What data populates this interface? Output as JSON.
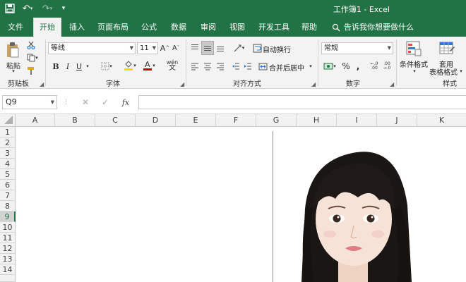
{
  "titlebar": {
    "title": "工作簿1 - Excel"
  },
  "tabs": [
    "文件",
    "开始",
    "插入",
    "页面布局",
    "公式",
    "数据",
    "审阅",
    "视图",
    "开发工具",
    "帮助"
  ],
  "active_tab": "开始",
  "tellme": "告诉我你想要做什么",
  "clipboard": {
    "paste": "粘贴",
    "group": "剪贴板"
  },
  "font": {
    "name": "等线",
    "size": "11",
    "bold": "B",
    "italic": "I",
    "underline": "U",
    "group": "字体",
    "phonetic": "wén"
  },
  "alignment": {
    "wrap": "自动换行",
    "merge": "合并后居中",
    "group": "对齐方式"
  },
  "number": {
    "format": "常规",
    "percent": "%",
    "comma": ",",
    "inc_dec": "←.0 .00",
    "dec_dec": ".00 →.0",
    "group": "数字"
  },
  "styles": {
    "conditional": "条件格式",
    "table_line1": "套用",
    "table_line2": "表格格式",
    "group": "样式"
  },
  "formula_bar": {
    "name_box": "Q9",
    "fx": "fx",
    "cancel": "✕",
    "enter": "✓"
  },
  "columns": [
    "A",
    "B",
    "C",
    "D",
    "E",
    "F",
    "G",
    "H",
    "I",
    "J",
    "K"
  ],
  "rows": [
    "1",
    "2",
    "3",
    "4",
    "5",
    "6",
    "7",
    "8",
    "9",
    "10",
    "11",
    "12",
    "13",
    "14"
  ],
  "selected_row": "9",
  "colors": {
    "brand": "#217346",
    "fill_color": "#ffd700",
    "font_color": "#c00000"
  }
}
